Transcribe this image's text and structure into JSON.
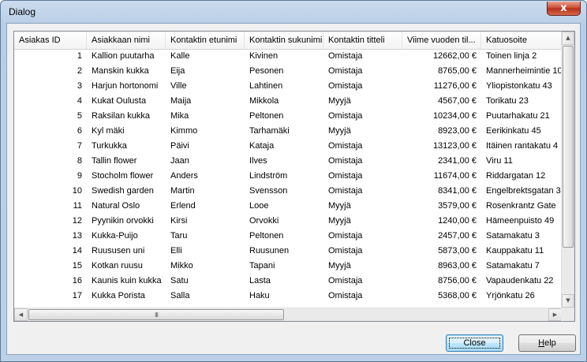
{
  "window": {
    "title": "Dialog",
    "close_glyph": "x"
  },
  "grid": {
    "columns": [
      "Asiakas ID",
      "Asiakkaan nimi",
      "Kontaktin etunimi",
      "Kontaktin sukunimi",
      "Kontaktin titteli",
      "Viime vuoden til...",
      "Katuosoite"
    ],
    "rows": [
      [
        "1",
        "Kallion puutarha",
        "Kalle",
        "Kivinen",
        "Omistaja",
        "12662,00 €",
        "Toinen linja 2"
      ],
      [
        "2",
        "Manskin kukka",
        "Eija",
        "Pesonen",
        "Omistaja",
        "8765,00 €",
        "Mannerheimintie 10"
      ],
      [
        "3",
        "Harjun hortonomi",
        "Ville",
        "Lahtinen",
        "Omistaja",
        "11276,00 €",
        "Yliopistonkatu 43"
      ],
      [
        "4",
        "Kukat Oulusta",
        "Maija",
        "Mikkola",
        "Myyjä",
        "4567,00 €",
        "Torikatu 23"
      ],
      [
        "5",
        "Raksilan kukka",
        "Mika",
        "Peltonen",
        "Omistaja",
        "10234,00 €",
        "Puutarhakatu 21"
      ],
      [
        "6",
        "Kyl mäki",
        "Kimmo",
        "Tarhamäki",
        "Myyjä",
        "8923,00 €",
        "Eerikinkatu 45"
      ],
      [
        "7",
        "Turkukka",
        "Päivi",
        "Kataja",
        "Omistaja",
        "13123,00 €",
        "Itäinen rantakatu 4"
      ],
      [
        "8",
        "Tallin flower",
        "Jaan",
        "Ilves",
        "Omistaja",
        "2341,00 €",
        "Viru 11"
      ],
      [
        "9",
        "Stocholm flower",
        "Anders",
        "Lindström",
        "Omistaja",
        "11674,00 €",
        "Riddargatan 12"
      ],
      [
        "10",
        "Swedish garden",
        "Martin",
        "Svensson",
        "Omistaja",
        "8341,00 €",
        "Engelbrektsgatan 3"
      ],
      [
        "11",
        "Natural Oslo",
        "Erlend",
        "Looe",
        "Myyjä",
        "3579,00 €",
        "Rosenkrantz Gate"
      ],
      [
        "12",
        "Pyynikin orvokki",
        "Kirsi",
        "Orvokki",
        "Myyjä",
        "1240,00 €",
        "Hämeenpuisto 49"
      ],
      [
        "13",
        "Kukka-Puijo",
        "Taru",
        "Peltonen",
        "Omistaja",
        "2457,00 €",
        "Satamakatu 3"
      ],
      [
        "14",
        "Ruususen uni",
        "Elli",
        "Ruusunen",
        "Omistaja",
        "5873,00 €",
        "Kauppakatu 11"
      ],
      [
        "15",
        "Kotkan ruusu",
        "Mikko",
        "Tapani",
        "Myyjä",
        "8963,00 €",
        "Satamakatu 7"
      ],
      [
        "16",
        "Kaunis kuin kukka",
        "Satu",
        "Lasta",
        "Omistaja",
        "8756,00 €",
        "Vapaudenkatu 22"
      ],
      [
        "17",
        "Kukka Porista",
        "Salla",
        "Haku",
        "Omistaja",
        "5368,00 €",
        "Yrjönkatu 26"
      ]
    ]
  },
  "buttons": {
    "close": "Close",
    "help_accel": "H",
    "help_rest": "elp"
  },
  "scroll": {
    "up": "▲",
    "down": "▼",
    "left": "◀",
    "right": "▶",
    "grip": "III"
  }
}
